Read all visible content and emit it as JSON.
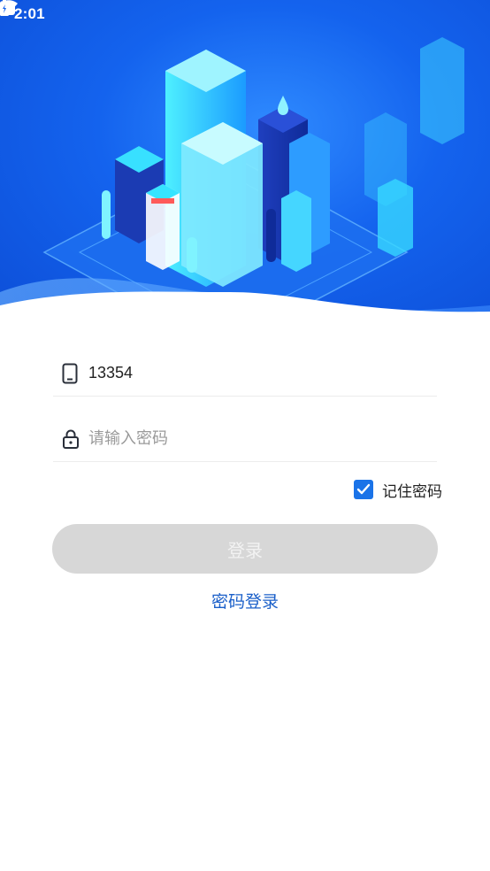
{
  "status_bar": {
    "time": "2:01",
    "icons_left": [
      "notification-icon",
      "app-icon",
      "keyboard-icon"
    ],
    "icons_right": [
      "wifi-icon",
      "signal-icon",
      "battery-icon"
    ]
  },
  "hero": {
    "illustration": "isometric-city-illustration"
  },
  "form": {
    "phone": {
      "value": "13354",
      "icon": "phone-icon"
    },
    "password": {
      "placeholder": "请输入密码",
      "icon": "lock-icon"
    },
    "remember": {
      "label": "记住密码",
      "checked": true
    },
    "login_button": "登录",
    "switch_link": "密码登录"
  },
  "colors": {
    "brand_blue": "#1463ee",
    "checkbox": "#1a73e8",
    "link": "#1a5fc9",
    "button_disabled": "#d7d7d7"
  }
}
